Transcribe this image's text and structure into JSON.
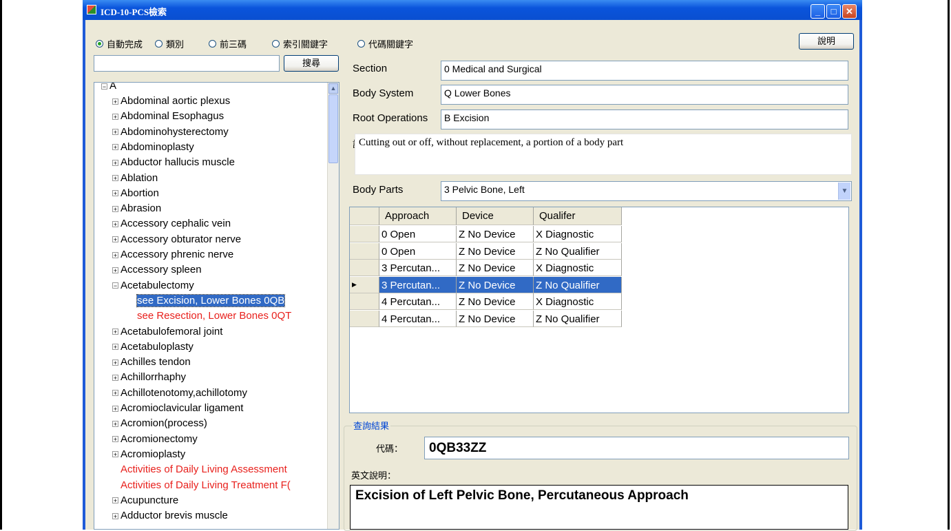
{
  "window": {
    "title": "ICD-10-PCS檢索"
  },
  "radio_options": [
    {
      "label": "自動完成",
      "selected": true
    },
    {
      "label": "類別",
      "selected": false
    },
    {
      "label": "前三碼",
      "selected": false
    },
    {
      "label": "索引關鍵字",
      "selected": false
    },
    {
      "label": "代碼關鍵字",
      "selected": false
    }
  ],
  "help_button": "說明",
  "search": {
    "value": "",
    "button": "搜尋"
  },
  "tree": {
    "root": "A",
    "items": [
      {
        "label": "Abdominal aortic plexus",
        "type": "node"
      },
      {
        "label": "Abdominal Esophagus",
        "type": "node"
      },
      {
        "label": "Abdominohysterectomy",
        "type": "node"
      },
      {
        "label": "Abdominoplasty",
        "type": "node"
      },
      {
        "label": "Abductor hallucis muscle",
        "type": "node"
      },
      {
        "label": "Ablation",
        "type": "node"
      },
      {
        "label": "Abortion",
        "type": "node"
      },
      {
        "label": "Abrasion",
        "type": "node"
      },
      {
        "label": "Accessory cephalic vein",
        "type": "node"
      },
      {
        "label": "Accessory obturator nerve",
        "type": "node"
      },
      {
        "label": "Accessory phrenic nerve",
        "type": "node"
      },
      {
        "label": "Accessory spleen",
        "type": "node"
      },
      {
        "label": "Acetabulectomy",
        "type": "expanded"
      },
      {
        "label": "see Excision, Lower Bones 0QB",
        "type": "child-selected"
      },
      {
        "label": "see Resection, Lower Bones 0QT",
        "type": "child-red"
      },
      {
        "label": "Acetabulofemoral joint",
        "type": "node"
      },
      {
        "label": "Acetabuloplasty",
        "type": "node"
      },
      {
        "label": "Achilles tendon",
        "type": "node"
      },
      {
        "label": "Achillorrhaphy",
        "type": "node"
      },
      {
        "label": "Achillotenotomy,achillotomy",
        "type": "node"
      },
      {
        "label": "Acromioclavicular ligament",
        "type": "node"
      },
      {
        "label": "Acromion(process)",
        "type": "node"
      },
      {
        "label": "Acromionectomy",
        "type": "node"
      },
      {
        "label": "Acromioplasty",
        "type": "node"
      },
      {
        "label": "Activities of Daily Living Assessment",
        "type": "leaf-red"
      },
      {
        "label": "Activities of Daily Living Treatment F(",
        "type": "leaf-red"
      },
      {
        "label": "Acupuncture",
        "type": "node"
      },
      {
        "label": "Adductor brevis muscle",
        "type": "node"
      }
    ]
  },
  "fields": {
    "section_label": "Section",
    "section_value": "0 Medical and Surgical",
    "body_system_label": "Body System",
    "body_system_value": "Q Lower Bones",
    "root_ops_label": "Root Operations",
    "root_ops_value": "B Excision",
    "desc_label": "說明",
    "desc_value": "Cutting out or off, without replacement, a portion of a body part",
    "body_parts_label": "Body Parts",
    "body_parts_value": "3 Pelvic Bone, Left"
  },
  "grid": {
    "columns": [
      "Approach",
      "Device",
      "Qualifer"
    ],
    "rows": [
      [
        "0 Open",
        "Z No Device",
        "X Diagnostic"
      ],
      [
        "0 Open",
        "Z No Device",
        "Z No Qualifier"
      ],
      [
        "3 Percutan...",
        "Z No Device",
        "X Diagnostic"
      ],
      [
        "3 Percutan...",
        "Z No Device",
        "Z No Qualifier"
      ],
      [
        "4 Percutan...",
        "Z No Device",
        "X Diagnostic"
      ],
      [
        "4 Percutan...",
        "Z No Device",
        "Z No Qualifier"
      ]
    ],
    "selected_row": 3
  },
  "result": {
    "group_title": "查詢結果",
    "code_label": "代碼：",
    "code_value": "0QB33ZZ",
    "en_label": "英文說明：",
    "en_value": "Excision of Left Pelvic Bone, Percutaneous Approach"
  }
}
